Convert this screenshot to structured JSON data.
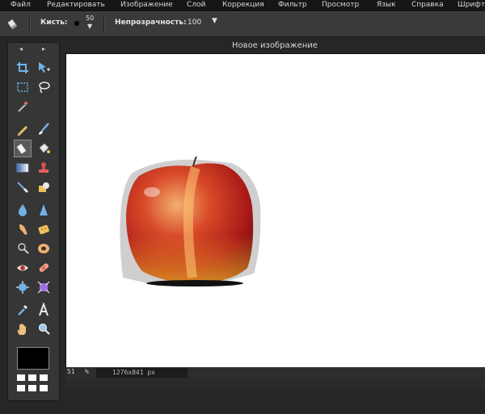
{
  "menu": [
    "Файл",
    "Редактировать",
    "Изображение",
    "Слой",
    "Коррекция",
    "Фильтр",
    "Просмотр",
    "Язык",
    "Справка",
    "Шрифт"
  ],
  "toolbar": {
    "brush_label": "Кисть:",
    "brush_size": "50",
    "opacity_label": "Непрозрачность:",
    "opacity_value": "100"
  },
  "panel": {
    "left_arrow": "◂",
    "right_arrow": "▸"
  },
  "tools": [
    [
      "crop-icon",
      "move-icon"
    ],
    [
      "marquee-select-icon",
      "lasso-icon"
    ],
    [
      "magic-wand-icon"
    ],
    [
      "pencil-icon",
      "brush-icon"
    ],
    [
      "eraser-icon",
      "paint-bucket-icon"
    ],
    [
      "gradient-icon",
      "clone-stamp-icon"
    ],
    [
      "color-replace-icon",
      "draw-shape-icon"
    ],
    [
      "blur-icon",
      "sharpen-icon"
    ],
    [
      "smudge-icon",
      "sponge-icon"
    ],
    [
      "dodge-icon",
      "burn-icon"
    ],
    [
      "red-eye-icon",
      "spot-heal-icon"
    ],
    [
      "bloat-icon",
      "pinch-icon"
    ],
    [
      "color-picker-icon",
      "type-icon"
    ],
    [
      "hand-icon",
      "zoom-icon"
    ]
  ],
  "primary_color": "#000000",
  "document": {
    "title": "Новое изображение",
    "zoom": "51",
    "zoom_unit": "%",
    "dimensions": "1276x841 px"
  }
}
